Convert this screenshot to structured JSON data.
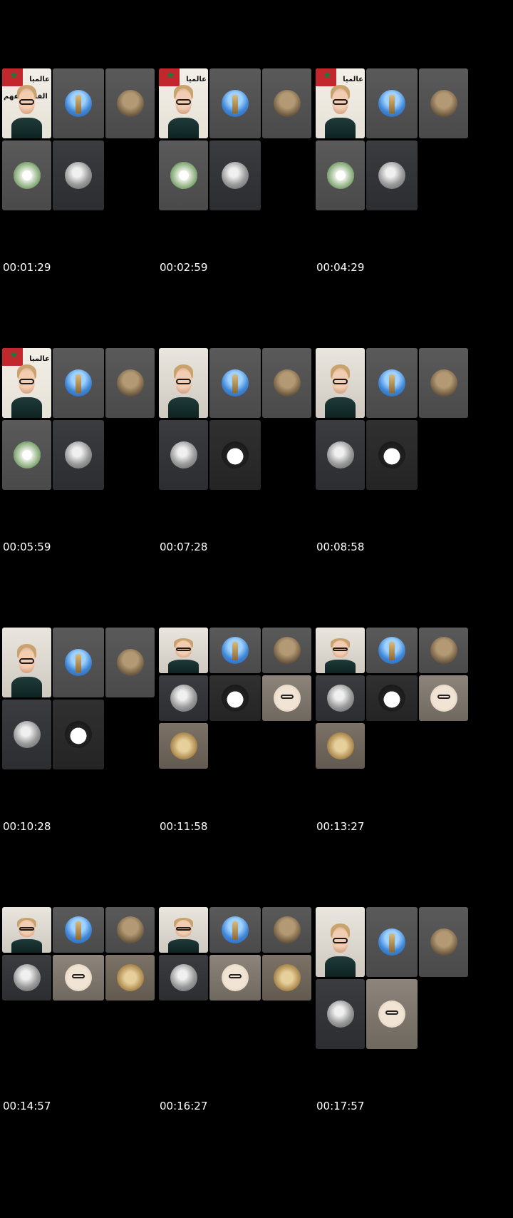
{
  "thumbnails": [
    {
      "timestamp": "00:01:29"
    },
    {
      "timestamp": "00:02:59"
    },
    {
      "timestamp": "00:04:29"
    },
    {
      "timestamp": "00:05:59"
    },
    {
      "timestamp": "00:07:28"
    },
    {
      "timestamp": "00:08:58"
    },
    {
      "timestamp": "00:10:28"
    },
    {
      "timestamp": "00:11:58"
    },
    {
      "timestamp": "00:13:27"
    },
    {
      "timestamp": "00:14:57"
    },
    {
      "timestamp": "00:16:27"
    },
    {
      "timestamp": "00:17:57"
    }
  ],
  "overlay_text": {
    "arabic_caption_1": "عالميا",
    "arabic_caption_2": "الفاهم يفهم"
  },
  "colors": {
    "background": "#000000",
    "tile_gray": "#555555",
    "flag_red": "#c1272d",
    "flag_star": "#1a7a3a"
  }
}
